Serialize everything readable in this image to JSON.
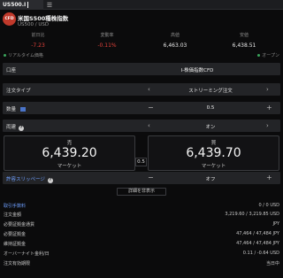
{
  "tab": {
    "label": "US500.I"
  },
  "instrument": {
    "logo": "CFD",
    "name": "米国S500種株指数",
    "symbol": "US500 / USD"
  },
  "ticker": [
    {
      "label": "前日比",
      "value": "-7.23",
      "negative": true
    },
    {
      "label": "変動率",
      "value": "-0.11%",
      "negative": true
    },
    {
      "label": "高値",
      "value": "6,463.03",
      "negative": false
    },
    {
      "label": "安値",
      "value": "6,438.51",
      "negative": false
    }
  ],
  "status": {
    "left": "リアルタイム価格",
    "right": "オープン"
  },
  "form": {
    "account_label": "口座",
    "account_value": "I-株価指数CFD",
    "order_type_label": "注文タイプ",
    "order_type_value": "ストリーミング注文",
    "quantity_label": "数量",
    "quantity_value": "0.5",
    "settle_label": "両建",
    "settle_value": "オン",
    "slippage_label": "許容スリッページ",
    "slippage_value": "オフ"
  },
  "sell": {
    "label": "売",
    "price": "6,439.20",
    "market": "マーケット"
  },
  "buy": {
    "label": "買",
    "price": "6,439.70",
    "market": "マーケット"
  },
  "spread": "0.5",
  "details_button": "詳細を非表示",
  "details": [
    {
      "k": "取引手数料",
      "v": "0 / 0 USD",
      "link": true
    },
    {
      "k": "注文金額",
      "v": "3,219.60 / 3,219.85 USD",
      "link": false
    },
    {
      "k": "必要証拠金通貨",
      "v": "JPY",
      "link": false
    },
    {
      "k": "必要証拠金",
      "v": "47,464 / 47,484 JPY",
      "link": false
    },
    {
      "k": "維持証拠金",
      "v": "47,464 / 47,484 JPY",
      "link": false
    },
    {
      "k": "オーバーナイト金利/日",
      "v": "0.11 / -0.64 USD",
      "link": false
    },
    {
      "k": "注文有効期限",
      "v": "当日中",
      "link": false
    }
  ],
  "colors": {
    "negative": "#e0413a",
    "link": "#6fa0ff",
    "logo": "#c0392b"
  }
}
